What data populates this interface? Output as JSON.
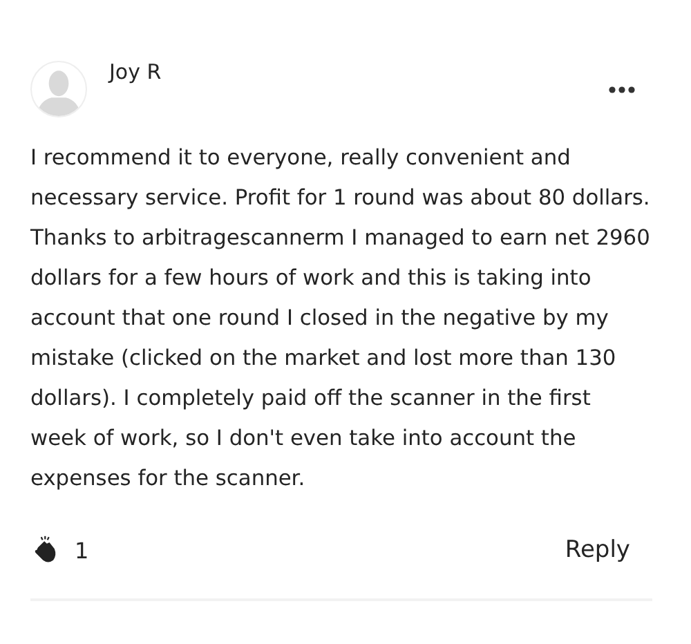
{
  "comment": {
    "author": "Joy R",
    "text": "I recommend it to everyone, really convenient and necessary service. Profit for 1 round was about 80 dollars. Thanks to arbitragescannerm I managed to earn net 2960 dollars for a few hours of work and this is taking into account that one round I closed in the negative by my mistake (clicked on the market and lost more than 130 dollars). I completely paid off the scanner in the first week of work, so I don't even take into account the expenses for the scanner.",
    "claps": "1",
    "reply": "Reply"
  }
}
